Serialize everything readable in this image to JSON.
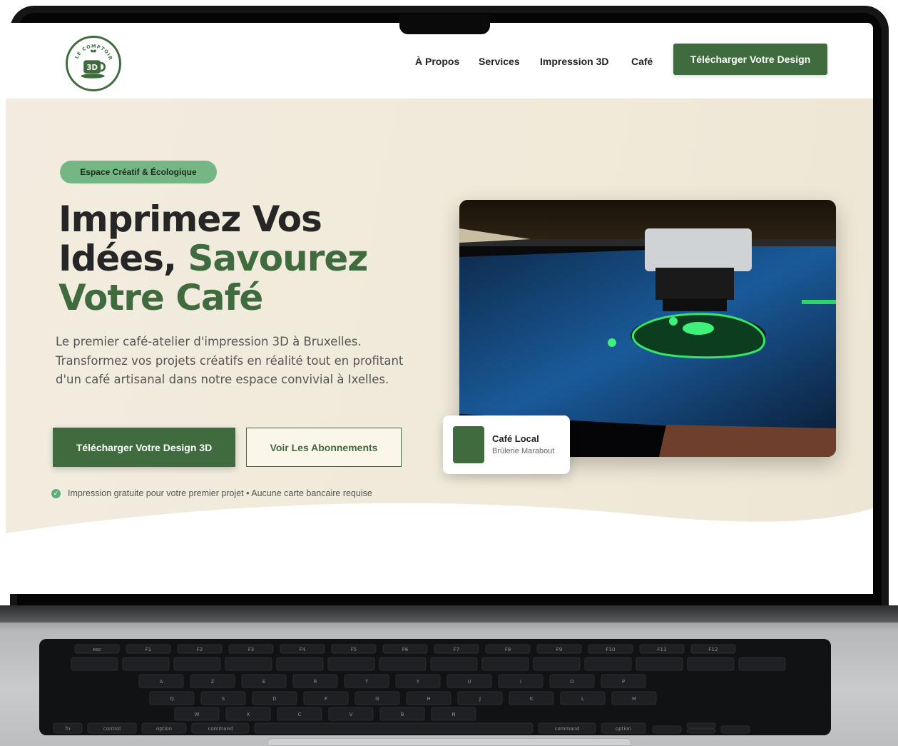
{
  "nav": {
    "logo_text_top": "LE COMPTOIR",
    "logo_text_mid": "3D",
    "links": [
      "À Propos",
      "Services",
      "Impression 3D",
      "Café"
    ],
    "cta": "Télécharger Votre Design"
  },
  "hero": {
    "badge": "Espace Créatif & Écologique",
    "headline_part1": "Imprimez Vos Idées,",
    "headline_part2": "Savourez Votre Café",
    "lead": "Le premier café-atelier d'impression 3D à Bruxelles. Transformez vos projets créatifs en réalité tout en profitant d'un café artisanal dans notre espace convivial à Ixelles.",
    "primary_button": "Télécharger Votre Design 3D",
    "secondary_button": "Voir Les Abonnements",
    "note": "Impression gratuite pour votre premier projet • Aucune carte bancaire requise"
  },
  "cafe_card": {
    "title": "Café Local",
    "subtitle": "Brûlerie Marabout"
  },
  "keyboard": {
    "row1": [
      "esc",
      "F1",
      "F2",
      "F3",
      "F4",
      "F5",
      "F6",
      "F7",
      "F8",
      "F9",
      "F10",
      "F11",
      "F12"
    ],
    "row3": [
      "A",
      "Z",
      "E",
      "R",
      "T",
      "Y",
      "U",
      "I",
      "O",
      "P"
    ],
    "row4": [
      "Q",
      "S",
      "D",
      "F",
      "G",
      "H",
      "J",
      "K",
      "L",
      "M"
    ],
    "row5": [
      "W",
      "X",
      "C",
      "V",
      "B",
      "N"
    ],
    "modifiers": [
      "fn",
      "control",
      "option",
      "command",
      "command",
      "option"
    ]
  },
  "colors": {
    "brand_green": "#3f6b3f",
    "badge_green": "#74b784",
    "hero_bg": "#f0ead9"
  }
}
